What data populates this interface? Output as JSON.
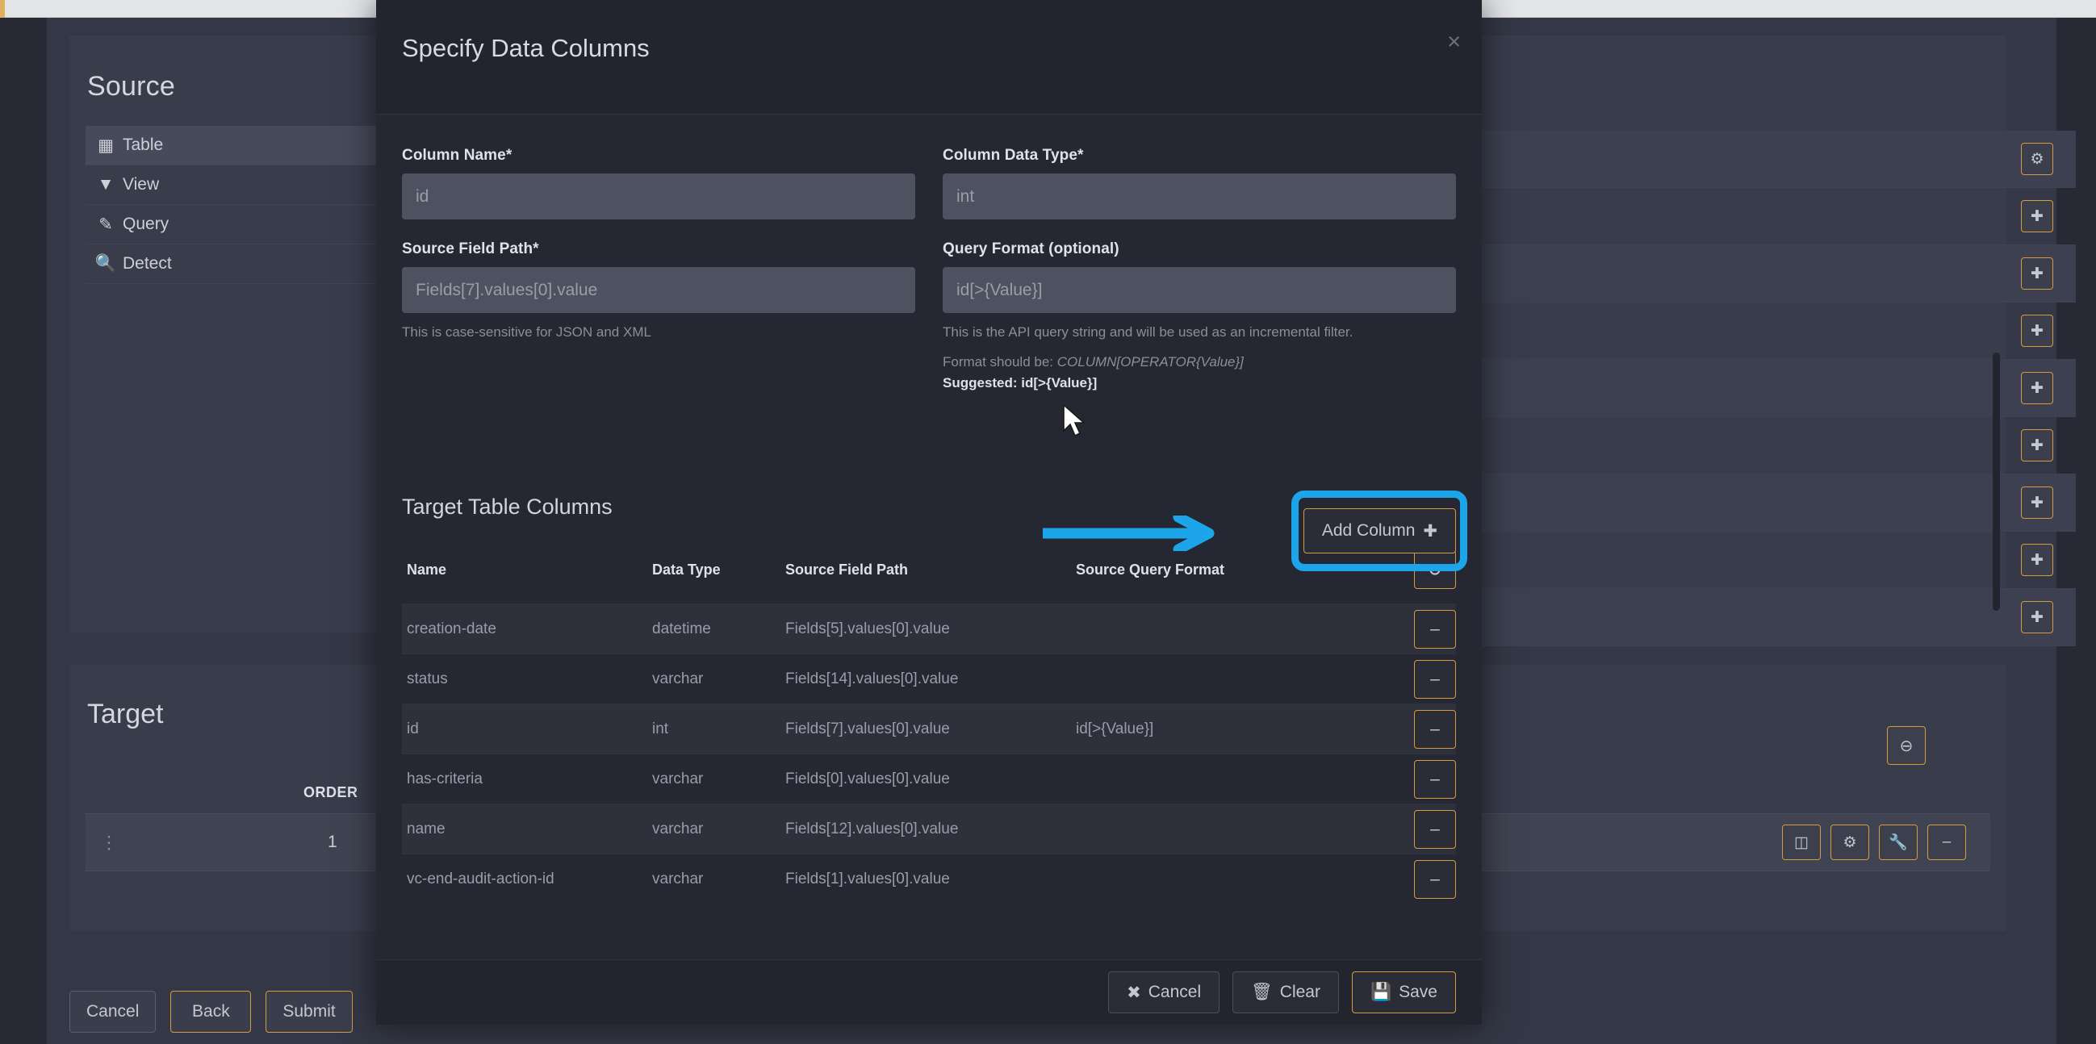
{
  "background": {
    "source_panel": {
      "title": "Source",
      "nav_items": [
        {
          "label": "Table",
          "icon": "table-icon",
          "active": true
        },
        {
          "label": "View",
          "icon": "filter-icon",
          "active": false
        },
        {
          "label": "Query",
          "icon": "edit-icon",
          "active": false
        },
        {
          "label": "Detect",
          "icon": "search-icon",
          "active": false
        }
      ],
      "row_buttons": [
        "gear-icon",
        "plus",
        "plus",
        "plus",
        "plus",
        "plus",
        "plus",
        "plus",
        "plus"
      ]
    },
    "target_panel": {
      "title": "Target",
      "order_header": "ORDER",
      "order_value": "1",
      "row_icons": [
        "columns-icon",
        "gear-icon",
        "wrench-icon",
        "minus-icon"
      ],
      "collapse_icon": "minus-circle-icon",
      "drag_handle": "drag-handle-icon"
    },
    "wizard_buttons": [
      {
        "label": "Cancel",
        "accent": false
      },
      {
        "label": "Back",
        "accent": true
      },
      {
        "label": "Submit",
        "accent": true
      }
    ]
  },
  "modal": {
    "title": "Specify Data Columns",
    "close_icon": "×",
    "fields": {
      "column_name": {
        "label": "Column Name*",
        "value": "",
        "placeholder": "id"
      },
      "column_data_type": {
        "label": "Column Data Type*",
        "value": "",
        "placeholder": "int"
      },
      "source_field_path": {
        "label": "Source Field Path*",
        "value": "",
        "placeholder": "Fields[7].values[0].value",
        "hint": "This is case-sensitive for JSON and XML"
      },
      "query_format": {
        "label": "Query Format (optional)",
        "value": "",
        "placeholder": "id[>{Value}]",
        "hint_line1": "This is the API query string and will be used as an incremental filter.",
        "hint_line2_prefix": "Format should be: ",
        "hint_line2_italic": "COLUMN[OPERATOR{Value}]",
        "suggested_label": "Suggested: id[>{Value}]"
      }
    },
    "add_column_button": {
      "label": "Add Column",
      "icon": "plus-icon"
    },
    "annotation": {
      "color": "#1ca5e8",
      "shape": "arrow-and-box"
    },
    "table": {
      "section_title": "Target Table Columns",
      "headers": [
        "Name",
        "Data Type",
        "Source Field Path",
        "Source Query Format"
      ],
      "header_action_icon": "minus-circle-icon",
      "row_action_icon": "minus-icon",
      "rows": [
        {
          "name": "creation-date",
          "type": "datetime",
          "path": "Fields[5].values[0].value",
          "query_format": ""
        },
        {
          "name": "status",
          "type": "varchar",
          "path": "Fields[14].values[0].value",
          "query_format": ""
        },
        {
          "name": "id",
          "type": "int",
          "path": "Fields[7].values[0].value",
          "query_format": "id[>{Value}]"
        },
        {
          "name": "has-criteria",
          "type": "varchar",
          "path": "Fields[0].values[0].value",
          "query_format": ""
        },
        {
          "name": "name",
          "type": "varchar",
          "path": "Fields[12].values[0].value",
          "query_format": ""
        },
        {
          "name": "vc-end-audit-action-id",
          "type": "varchar",
          "path": "Fields[1].values[0].value",
          "query_format": ""
        }
      ]
    },
    "footer_buttons": [
      {
        "label": "Cancel",
        "icon": "close-icon",
        "accent": false
      },
      {
        "label": "Clear",
        "icon": "trash-icon",
        "accent": false
      },
      {
        "label": "Save",
        "icon": "save-icon",
        "accent": true
      }
    ]
  },
  "theme": {
    "accent_orange": "#d79b3e",
    "annotation_blue": "#1ca5e8",
    "modal_bg": "#22242e",
    "panel_bg": "#393c4b"
  }
}
